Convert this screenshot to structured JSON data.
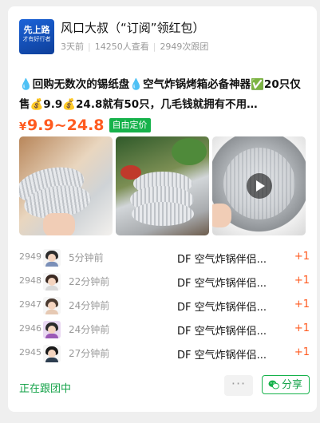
{
  "header": {
    "avatar_line1": "先上路",
    "avatar_line2": "才有好行者",
    "title": "风口大叔（“订阅”领红包）",
    "time_ago": "3天前",
    "views": "14250人查看",
    "followers": "2949次跟团"
  },
  "post": {
    "description": "💧回购无数次的锡纸盘💧空气炸锅烤箱必备神器✅20只仅售💰9.9💰24.8就有50只，几毛钱就拥有不用…",
    "price_symbol": "¥",
    "price_range": "9.9~24.8",
    "price_badge": "自由定价"
  },
  "images": [
    {
      "name": "foil-trays-air-fryer-image"
    },
    {
      "name": "foil-trays-stack-image"
    },
    {
      "name": "foil-tray-video-thumbnail",
      "has_play_button": true
    }
  ],
  "buyers": [
    {
      "number": "2949",
      "time_ago": "5分钟前",
      "item": "DF 空气炸锅伴侣...",
      "qty": "+1"
    },
    {
      "number": "2948",
      "time_ago": "22分钟前",
      "item": "DF 空气炸锅伴侣...",
      "qty": "+1"
    },
    {
      "number": "2947",
      "time_ago": "24分钟前",
      "item": "DF 空气炸锅伴侣...",
      "qty": "+1"
    },
    {
      "number": "2946",
      "time_ago": "24分钟前",
      "item": "DF 空气炸锅伴侣...",
      "qty": "+1"
    },
    {
      "number": "2945",
      "time_ago": "27分钟前",
      "item": "DF 空气炸锅伴侣...",
      "qty": "+1"
    }
  ],
  "footer": {
    "status": "正在跟团中",
    "more_label": "···",
    "share_label": "分享"
  },
  "colors": {
    "accent_green": "#16b24b",
    "price_orange": "#ff5a1f",
    "avatar_blue": "#1b63d8"
  }
}
